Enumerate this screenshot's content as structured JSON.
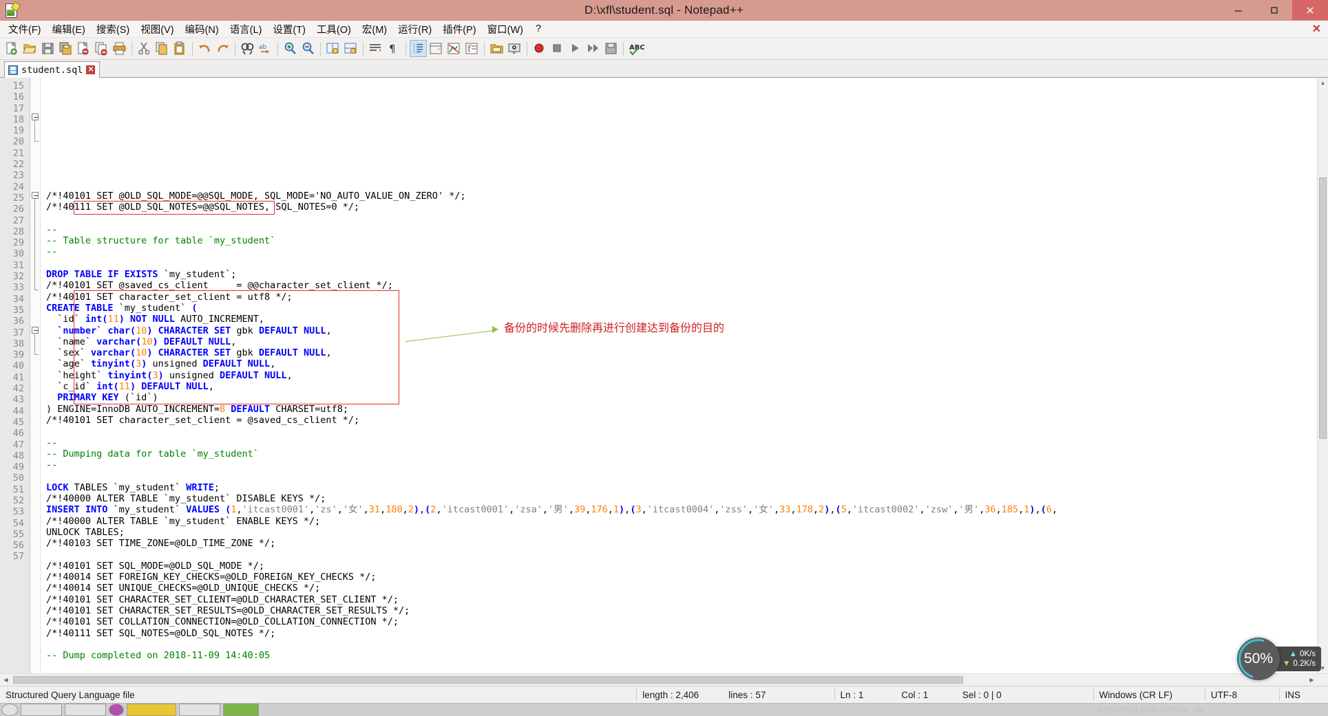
{
  "window": {
    "title": "D:\\xfl\\student.sql - Notepad++",
    "titlebar_color": "#d79a8f",
    "minimize_label": "—",
    "maximize_label": "❐",
    "close_label": "✕"
  },
  "menu": {
    "items": [
      {
        "label": "文件(F)",
        "name": "menu-file"
      },
      {
        "label": "编辑(E)",
        "name": "menu-edit"
      },
      {
        "label": "搜索(S)",
        "name": "menu-search"
      },
      {
        "label": "视图(V)",
        "name": "menu-view"
      },
      {
        "label": "编码(N)",
        "name": "menu-encoding"
      },
      {
        "label": "语言(L)",
        "name": "menu-language"
      },
      {
        "label": "设置(T)",
        "name": "menu-settings"
      },
      {
        "label": "工具(O)",
        "name": "menu-tools"
      },
      {
        "label": "宏(M)",
        "name": "menu-macro"
      },
      {
        "label": "运行(R)",
        "name": "menu-run"
      },
      {
        "label": "插件(P)",
        "name": "menu-plugins"
      },
      {
        "label": "窗口(W)",
        "name": "menu-window"
      },
      {
        "label": "?",
        "name": "menu-help"
      }
    ],
    "doc_close": "✕"
  },
  "toolbar": {
    "icons": [
      "new-file-icon",
      "open-file-icon",
      "save-icon",
      "save-all-icon",
      "close-file-icon",
      "close-all-icon",
      "print-icon",
      "cut-icon",
      "copy-icon",
      "paste-icon",
      "undo-icon",
      "redo-icon",
      "find-icon",
      "replace-icon",
      "zoom-in-icon",
      "zoom-out-icon",
      "sync-vertical-icon",
      "sync-horizontal-icon",
      "word-wrap-icon",
      "show-all-chars-icon",
      "indent-guide-icon",
      "ui-pane-icon",
      "document-map-icon",
      "function-list-icon",
      "folder-workspace-icon",
      "monitor-icon",
      "record-macro-icon",
      "stop-macro-icon",
      "play-macro-icon",
      "fast-play-macro-icon",
      "save-macro-icon",
      "spell-check-icon"
    ]
  },
  "tabs": [
    {
      "label": "student.sql",
      "icon": "sql-file-icon",
      "close": "✕",
      "active": true
    }
  ],
  "editor": {
    "first_visible_line": 15,
    "lines": [
      {
        "n": 15,
        "tokens": [
          {
            "t": "/*!40101 SET @OLD_SQL_MODE=@@SQL_MODE, SQL_MODE='NO_AUTO_VALUE_ON_ZERO' */;",
            "c": "plain"
          }
        ]
      },
      {
        "n": 16,
        "tokens": [
          {
            "t": "/*!40111 SET @OLD_SQL_NOTES=@@SQL_NOTES, SQL_NOTES=0 */;",
            "c": "plain"
          }
        ]
      },
      {
        "n": 17,
        "tokens": []
      },
      {
        "n": 18,
        "tokens": [
          {
            "t": "--",
            "c": "com"
          }
        ]
      },
      {
        "n": 19,
        "tokens": [
          {
            "t": "-- Table structure for table `my_student`",
            "c": "com"
          }
        ]
      },
      {
        "n": 20,
        "tokens": [
          {
            "t": "--",
            "c": "com"
          }
        ]
      },
      {
        "n": 21,
        "tokens": []
      },
      {
        "n": 22,
        "tokens": [
          {
            "t": "DROP TABLE IF EXISTS",
            "c": "kw"
          },
          {
            "t": " `my_student`;",
            "c": "plain"
          }
        ]
      },
      {
        "n": 23,
        "tokens": [
          {
            "t": "/*!40101 SET @saved_cs_client     = @@character_set_client */;",
            "c": "plain"
          }
        ]
      },
      {
        "n": 24,
        "tokens": [
          {
            "t": "/*!40101 SET character_set_client = utf8 */;",
            "c": "plain"
          }
        ]
      },
      {
        "n": 25,
        "tokens": [
          {
            "t": "CREATE TABLE",
            "c": "kw"
          },
          {
            "t": " `my_student` ",
            "c": "plain"
          },
          {
            "t": "(",
            "c": "kw"
          }
        ]
      },
      {
        "n": 26,
        "tokens": [
          {
            "t": "  `id` ",
            "c": "plain"
          },
          {
            "t": "int",
            "c": "kw"
          },
          {
            "t": "(",
            "c": "kw"
          },
          {
            "t": "11",
            "c": "num"
          },
          {
            "t": ") ",
            "c": "kw"
          },
          {
            "t": "NOT NULL",
            "c": "kw"
          },
          {
            "t": " AUTO_INCREMENT,",
            "c": "plain"
          }
        ]
      },
      {
        "n": 27,
        "tokens": [
          {
            "t": "  ",
            "c": "plain"
          },
          {
            "t": "`number`",
            "c": "kw"
          },
          {
            "t": " ",
            "c": "plain"
          },
          {
            "t": "char",
            "c": "kw"
          },
          {
            "t": "(",
            "c": "kw"
          },
          {
            "t": "10",
            "c": "num"
          },
          {
            "t": ") ",
            "c": "kw"
          },
          {
            "t": "CHARACTER SET",
            "c": "kw"
          },
          {
            "t": " gbk ",
            "c": "plain"
          },
          {
            "t": "DEFAULT NULL",
            "c": "kw"
          },
          {
            "t": ",",
            "c": "plain"
          }
        ]
      },
      {
        "n": 28,
        "tokens": [
          {
            "t": "  `name` ",
            "c": "plain"
          },
          {
            "t": "varchar",
            "c": "kw"
          },
          {
            "t": "(",
            "c": "kw"
          },
          {
            "t": "10",
            "c": "num"
          },
          {
            "t": ") ",
            "c": "kw"
          },
          {
            "t": "DEFAULT NULL",
            "c": "kw"
          },
          {
            "t": ",",
            "c": "plain"
          }
        ]
      },
      {
        "n": 29,
        "tokens": [
          {
            "t": "  `sex` ",
            "c": "plain"
          },
          {
            "t": "varchar",
            "c": "kw"
          },
          {
            "t": "(",
            "c": "kw"
          },
          {
            "t": "10",
            "c": "num"
          },
          {
            "t": ") ",
            "c": "kw"
          },
          {
            "t": "CHARACTER SET",
            "c": "kw"
          },
          {
            "t": " gbk ",
            "c": "plain"
          },
          {
            "t": "DEFAULT NULL",
            "c": "kw"
          },
          {
            "t": ",",
            "c": "plain"
          }
        ]
      },
      {
        "n": 30,
        "tokens": [
          {
            "t": "  `age` ",
            "c": "plain"
          },
          {
            "t": "tinyint",
            "c": "kw"
          },
          {
            "t": "(",
            "c": "kw"
          },
          {
            "t": "3",
            "c": "num"
          },
          {
            "t": ") ",
            "c": "kw"
          },
          {
            "t": "unsigned ",
            "c": "plain"
          },
          {
            "t": "DEFAULT NULL",
            "c": "kw"
          },
          {
            "t": ",",
            "c": "plain"
          }
        ]
      },
      {
        "n": 31,
        "tokens": [
          {
            "t": "  `height` ",
            "c": "plain"
          },
          {
            "t": "tinyint",
            "c": "kw"
          },
          {
            "t": "(",
            "c": "kw"
          },
          {
            "t": "3",
            "c": "num"
          },
          {
            "t": ") ",
            "c": "kw"
          },
          {
            "t": "unsigned ",
            "c": "plain"
          },
          {
            "t": "DEFAULT NULL",
            "c": "kw"
          },
          {
            "t": ",",
            "c": "plain"
          }
        ]
      },
      {
        "n": 32,
        "tokens": [
          {
            "t": "  `c_id` ",
            "c": "plain"
          },
          {
            "t": "int",
            "c": "kw"
          },
          {
            "t": "(",
            "c": "kw"
          },
          {
            "t": "11",
            "c": "num"
          },
          {
            "t": ") ",
            "c": "kw"
          },
          {
            "t": "DEFAULT NULL",
            "c": "kw"
          },
          {
            "t": ",",
            "c": "plain"
          }
        ]
      },
      {
        "n": 33,
        "tokens": [
          {
            "t": "  ",
            "c": "plain"
          },
          {
            "t": "PRIMARY KEY",
            "c": "kw"
          },
          {
            "t": " (`id`)",
            "c": "plain"
          }
        ]
      },
      {
        "n": 34,
        "tokens": [
          {
            "t": ") ENGINE=InnoDB AUTO_INCREMENT=",
            "c": "plain"
          },
          {
            "t": "8",
            "c": "num"
          },
          {
            "t": " ",
            "c": "plain"
          },
          {
            "t": "DEFAULT",
            "c": "kw"
          },
          {
            "t": " CHARSET=utf8;",
            "c": "plain"
          }
        ]
      },
      {
        "n": 35,
        "tokens": [
          {
            "t": "/*!40101 SET character_set_client = @saved_cs_client */;",
            "c": "plain"
          }
        ]
      },
      {
        "n": 36,
        "tokens": []
      },
      {
        "n": 37,
        "tokens": [
          {
            "t": "--",
            "c": "com"
          }
        ]
      },
      {
        "n": 38,
        "tokens": [
          {
            "t": "-- Dumping data for table `my_student`",
            "c": "com"
          }
        ]
      },
      {
        "n": 39,
        "tokens": [
          {
            "t": "--",
            "c": "com"
          }
        ]
      },
      {
        "n": 40,
        "tokens": []
      },
      {
        "n": 41,
        "tokens": [
          {
            "t": "LOCK",
            "c": "kw"
          },
          {
            "t": " TABLES `my_student` ",
            "c": "plain"
          },
          {
            "t": "WRITE",
            "c": "kw"
          },
          {
            "t": ";",
            "c": "plain"
          }
        ]
      },
      {
        "n": 42,
        "tokens": [
          {
            "t": "/*!40000 ALTER TABLE `my_student` DISABLE KEYS */;",
            "c": "plain"
          }
        ]
      },
      {
        "n": 43,
        "tokens": [
          {
            "t": "INSERT INTO",
            "c": "kw"
          },
          {
            "t": " `my_student` ",
            "c": "plain"
          },
          {
            "t": "VALUES",
            "c": "kw"
          },
          {
            "t": " ",
            "c": "plain"
          },
          {
            "t": "(",
            "c": "kw"
          },
          {
            "t": "1",
            "c": "num"
          },
          {
            "t": ",",
            "c": "plain"
          },
          {
            "t": "'itcast0001'",
            "c": "str"
          },
          {
            "t": ",",
            "c": "plain"
          },
          {
            "t": "'zs'",
            "c": "str"
          },
          {
            "t": ",",
            "c": "plain"
          },
          {
            "t": "'女'",
            "c": "str"
          },
          {
            "t": ",",
            "c": "plain"
          },
          {
            "t": "31",
            "c": "num"
          },
          {
            "t": ",",
            "c": "plain"
          },
          {
            "t": "180",
            "c": "num"
          },
          {
            "t": ",",
            "c": "plain"
          },
          {
            "t": "2",
            "c": "num"
          },
          {
            "t": ")",
            "c": "kw"
          },
          {
            "t": ",",
            "c": "plain"
          },
          {
            "t": "(",
            "c": "kw"
          },
          {
            "t": "2",
            "c": "num"
          },
          {
            "t": ",",
            "c": "plain"
          },
          {
            "t": "'itcast0001'",
            "c": "str"
          },
          {
            "t": ",",
            "c": "plain"
          },
          {
            "t": "'zsa'",
            "c": "str"
          },
          {
            "t": ",",
            "c": "plain"
          },
          {
            "t": "'男'",
            "c": "str"
          },
          {
            "t": ",",
            "c": "plain"
          },
          {
            "t": "39",
            "c": "num"
          },
          {
            "t": ",",
            "c": "plain"
          },
          {
            "t": "176",
            "c": "num"
          },
          {
            "t": ",",
            "c": "plain"
          },
          {
            "t": "1",
            "c": "num"
          },
          {
            "t": ")",
            "c": "kw"
          },
          {
            "t": ",",
            "c": "plain"
          },
          {
            "t": "(",
            "c": "kw"
          },
          {
            "t": "3",
            "c": "num"
          },
          {
            "t": ",",
            "c": "plain"
          },
          {
            "t": "'itcast0004'",
            "c": "str"
          },
          {
            "t": ",",
            "c": "plain"
          },
          {
            "t": "'zss'",
            "c": "str"
          },
          {
            "t": ",",
            "c": "plain"
          },
          {
            "t": "'女'",
            "c": "str"
          },
          {
            "t": ",",
            "c": "plain"
          },
          {
            "t": "33",
            "c": "num"
          },
          {
            "t": ",",
            "c": "plain"
          },
          {
            "t": "178",
            "c": "num"
          },
          {
            "t": ",",
            "c": "plain"
          },
          {
            "t": "2",
            "c": "num"
          },
          {
            "t": ")",
            "c": "kw"
          },
          {
            "t": ",",
            "c": "plain"
          },
          {
            "t": "(",
            "c": "kw"
          },
          {
            "t": "5",
            "c": "num"
          },
          {
            "t": ",",
            "c": "plain"
          },
          {
            "t": "'itcast0002'",
            "c": "str"
          },
          {
            "t": ",",
            "c": "plain"
          },
          {
            "t": "'zsw'",
            "c": "str"
          },
          {
            "t": ",",
            "c": "plain"
          },
          {
            "t": "'男'",
            "c": "str"
          },
          {
            "t": ",",
            "c": "plain"
          },
          {
            "t": "36",
            "c": "num"
          },
          {
            "t": ",",
            "c": "plain"
          },
          {
            "t": "185",
            "c": "num"
          },
          {
            "t": ",",
            "c": "plain"
          },
          {
            "t": "1",
            "c": "num"
          },
          {
            "t": ")",
            "c": "kw"
          },
          {
            "t": ",",
            "c": "plain"
          },
          {
            "t": "(",
            "c": "kw"
          },
          {
            "t": "6",
            "c": "num"
          },
          {
            "t": ",",
            "c": "plain"
          }
        ]
      },
      {
        "n": 44,
        "tokens": [
          {
            "t": "/*!40000 ALTER TABLE `my_student` ENABLE KEYS */;",
            "c": "plain"
          }
        ]
      },
      {
        "n": 45,
        "tokens": [
          {
            "t": "UNLOCK TABLES;",
            "c": "plain"
          }
        ]
      },
      {
        "n": 46,
        "tokens": [
          {
            "t": "/*!40103 SET TIME_ZONE=@OLD_TIME_ZONE */;",
            "c": "plain"
          }
        ]
      },
      {
        "n": 47,
        "tokens": []
      },
      {
        "n": 48,
        "tokens": [
          {
            "t": "/*!40101 SET SQL_MODE=@OLD_SQL_MODE */;",
            "c": "plain"
          }
        ]
      },
      {
        "n": 49,
        "tokens": [
          {
            "t": "/*!40014 SET FOREIGN_KEY_CHECKS=@OLD_FOREIGN_KEY_CHECKS */;",
            "c": "plain"
          }
        ]
      },
      {
        "n": 50,
        "tokens": [
          {
            "t": "/*!40014 SET UNIQUE_CHECKS=@OLD_UNIQUE_CHECKS */;",
            "c": "plain"
          }
        ]
      },
      {
        "n": 51,
        "tokens": [
          {
            "t": "/*!40101 SET CHARACTER_SET_CLIENT=@OLD_CHARACTER_SET_CLIENT */;",
            "c": "plain"
          }
        ]
      },
      {
        "n": 52,
        "tokens": [
          {
            "t": "/*!40101 SET CHARACTER_SET_RESULTS=@OLD_CHARACTER_SET_RESULTS */;",
            "c": "plain"
          }
        ]
      },
      {
        "n": 53,
        "tokens": [
          {
            "t": "/*!40101 SET COLLATION_CONNECTION=@OLD_COLLATION_CONNECTION */;",
            "c": "plain"
          }
        ]
      },
      {
        "n": 54,
        "tokens": [
          {
            "t": "/*!40111 SET SQL_NOTES=@OLD_SQL_NOTES */;",
            "c": "plain"
          }
        ]
      },
      {
        "n": 55,
        "tokens": []
      },
      {
        "n": 56,
        "tokens": [
          {
            "t": "-- Dump completed on 2018-11-09 14:40:05",
            "c": "com"
          }
        ]
      },
      {
        "n": 57,
        "tokens": []
      }
    ]
  },
  "annotation": {
    "text": "备份的时候先删除再进行创建达到备份的目的",
    "color": "#d02020",
    "arrow_color": "#8fbf3f"
  },
  "status": {
    "doc_type": "Structured Query Language file",
    "length_label": "length : 2,406",
    "lines_label": "lines : 57",
    "ln": "Ln : 1",
    "col": "Col : 1",
    "sel": "Sel : 0 | 0",
    "eol": "Windows (CR LF)",
    "encoding": "UTF-8",
    "insert_mode": "INS"
  },
  "watermark": "http://blog.csdn.net/aa...ab",
  "speed_widget": {
    "percent": "50%",
    "upload": "0K/s",
    "download": "0.2K/s",
    "up_icon": "arrow-up-icon",
    "down_icon": "arrow-down-icon"
  },
  "scroll": {
    "up_arrow": "▲",
    "down_arrow": "▼",
    "left_arrow": "◀",
    "right_arrow": "▶"
  }
}
